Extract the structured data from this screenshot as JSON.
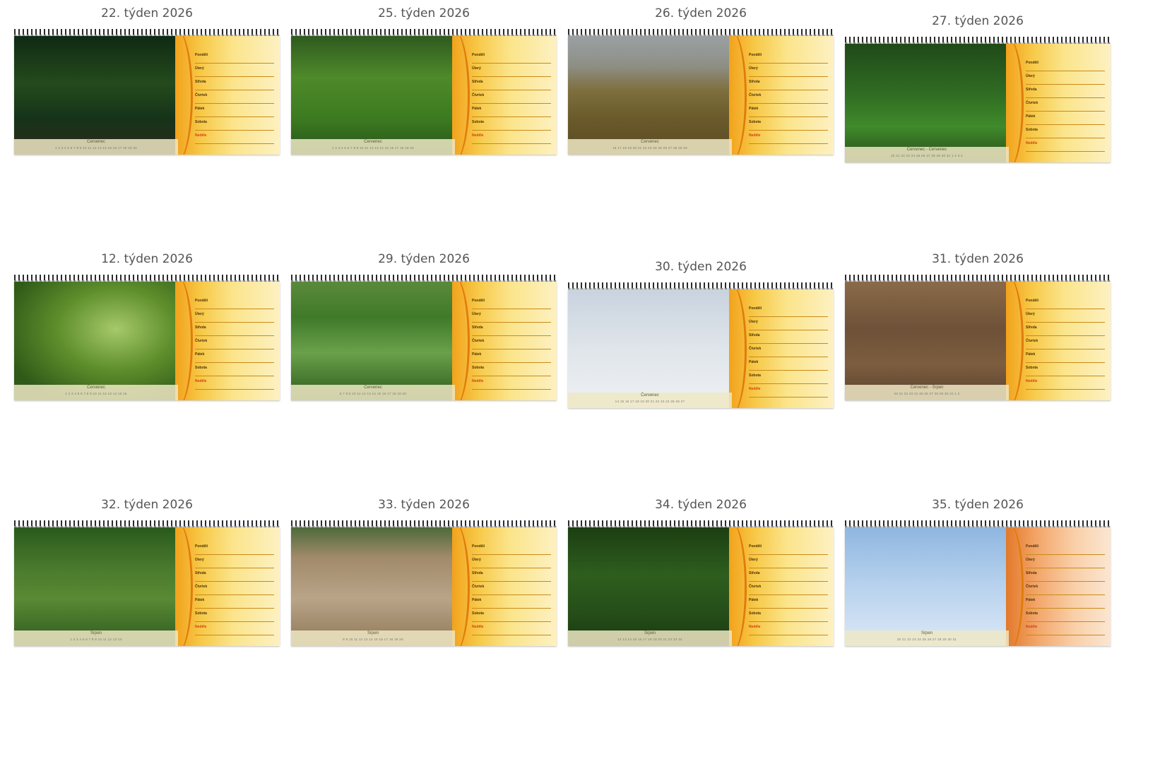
{
  "cards": [
    {
      "title": "22. týden 2026",
      "scene": "sc-forest",
      "month": "Červenec",
      "days": "1 2 3 4 5 6 7 8 9 10 11 12 13 14 15 16 17 18 19 20"
    },
    {
      "title": "25. týden 2026",
      "scene": "sc-jungle",
      "month": "Červenec",
      "days": "1 2 3 4 5 6 7 8 9 10 11 12 13 14 15 16 17 18 19 20"
    },
    {
      "title": "26. týden 2026",
      "scene": "sc-savanna",
      "month": "Červenec",
      "days": "16 17 18 19 20 21 22 23 24 25 26 27 28 29 30"
    },
    {
      "title": "27. týden 2026",
      "scene": "sc-green",
      "month": "Červenec - Červenec",
      "days": "20 21 22 23 24 25 26 27 28 29 30 31 1 2 3 4"
    },
    {
      "title": "12. týden 2026",
      "scene": "sc-soft",
      "month": "Červenec",
      "days": "1 2 3 4 5 6 7 8 9 10 11 12 13 14 15 16"
    },
    {
      "title": "29. týden 2026",
      "scene": "sc-grove",
      "month": "Červenec",
      "days": "6 7 8 9 10 11 12 13 14 15 16 17 18 19 20"
    },
    {
      "title": "30. týden 2026",
      "scene": "sc-sky",
      "month": "Červenec",
      "days": "14 15 16 17 18 19 20 21 22 23 24 25 26 27"
    },
    {
      "title": "31. týden 2026",
      "scene": "sc-soil",
      "month": "Červenec - Srpen",
      "days": "20 21 22 23 24 25 26 27 28 29 30 31 1 2"
    },
    {
      "title": "32. týden 2026",
      "scene": "sc-elephant",
      "month": "Srpen",
      "days": "1 2 3 4 5 6 7 8 9 10 11 12 13 14"
    },
    {
      "title": "33. týden 2026",
      "scene": "sc-hippo",
      "month": "Srpen",
      "days": "8 9 10 11 12 13 14 15 16 17 18 19 20"
    },
    {
      "title": "34. týden 2026",
      "scene": "sc-macaque",
      "month": "Srpen",
      "days": "12 13 14 15 16 17 18 19 20 21 22 23 24"
    },
    {
      "title": "35. týden 2026",
      "scene": "sc-bluesky",
      "month": "Srpen",
      "days": "20 21 22 23 24 25 26 27 28 29 30 31",
      "planner_style": "orange"
    }
  ],
  "planner": {
    "days": [
      "Pondělí",
      "Úterý",
      "Středa",
      "Čtvrtek",
      "Pátek",
      "Sobota",
      "Neděle"
    ]
  }
}
